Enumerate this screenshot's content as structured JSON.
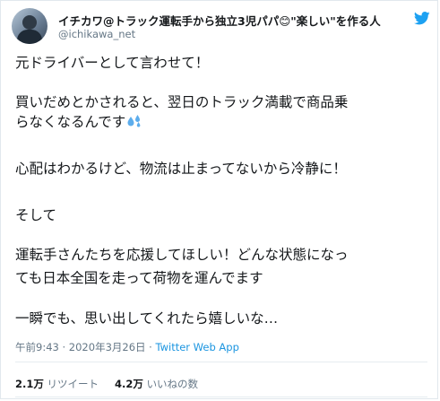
{
  "tweet": {
    "author": {
      "display_name": "イチカワ@トラック運転手から独立3児パパ😊\"楽しい\"を作る人",
      "handle": "@ichikawa_net"
    },
    "text_lines": [
      "元ドライバーとして言わせて！",
      "買いだめとかされると、翌日のトラック満載で商品乗",
      "らなくなるんです",
      "心配はわかるけど、物流は止まってないから冷静に！",
      "そして",
      "運転手さんたちを応援してほしい！どんな状態になっ",
      "ても日本全国を走って荷物を運んでます",
      "一瞬でも、思い出してくれたら嬉しいな…"
    ],
    "time": "午前9:43",
    "separator": " · ",
    "date": "2020年3月26日",
    "source": "Twitter Web App",
    "retweets": {
      "count": "2.1万",
      "label": "リツイート"
    },
    "likes": {
      "count": "4.2万",
      "label": "いいねの数"
    }
  },
  "colors": {
    "text": "#14171a",
    "muted": "#657786",
    "link": "#1b95e0",
    "twitter_blue": "#1da1f2",
    "sweat_blue": "#5dadec"
  },
  "icons": {
    "brand": "twitter-bird-icon",
    "emoji": "sweat-droplets-icon"
  }
}
